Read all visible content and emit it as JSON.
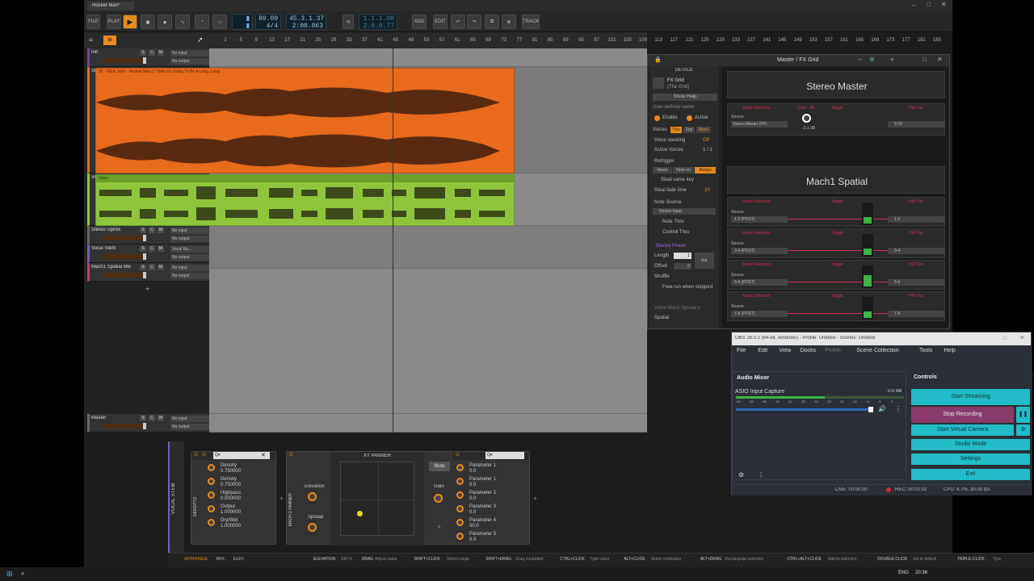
{
  "window": {
    "tab_title": "Rocket Man*"
  },
  "toolbar": {
    "file": "FILE",
    "play": "PLAY",
    "tempo": "89.00",
    "timesig": "4/4",
    "position_bars": "45.3.1.37",
    "position_time": "2:00.063",
    "loop_start": "1.1.1.00",
    "loop_end": "2.0.0.77",
    "add": "ADD",
    "edit": "EDIT",
    "track": "TRACK"
  },
  "ruler": {
    "ticks": [
      "1",
      "5",
      "9",
      "13",
      "17",
      "21",
      "25",
      "29",
      "33",
      "37",
      "41",
      "45",
      "49",
      "53",
      "57",
      "61",
      "65",
      "69",
      "73",
      "77",
      "81",
      "85",
      "89",
      "93",
      "97",
      "101",
      "105",
      "109",
      "113",
      "117",
      "121",
      "125",
      "129",
      "133",
      "137",
      "141",
      "145",
      "149",
      "153",
      "157",
      "161",
      "165",
      "169",
      "173",
      "177",
      "181",
      "185"
    ]
  },
  "tracks": [
    {
      "name": "Init",
      "in": "No input",
      "out": "No output",
      "color": "#8a3aa8"
    },
    {
      "name": "Stereo Master",
      "in": "No input",
      "out": "No output",
      "color": "#e86a1c"
    },
    {
      "name": "Vocal RipX",
      "in": "No input",
      "out": "No output",
      "color": "#8fc43c"
    },
    {
      "name": "Stereo Upmix",
      "in": "No input",
      "out": "No output",
      "color": "#666666"
    },
    {
      "name": "Vocal Stem",
      "in": "Vocal Ru...",
      "out": "No output",
      "color": "#7a5ac8"
    },
    {
      "name": "Mach1 Spatial Mix",
      "in": "No input",
      "out": "No output",
      "color": "#c83a7a"
    },
    {
      "name": "Master",
      "in": "No input",
      "out": "No output",
      "color": "#666666"
    }
  ],
  "clips": {
    "clip1_title": "05 - Elton John - Rocket Man (I Think It's Going To Be A Long, Long",
    "clip2_title": "Voice"
  },
  "inspector": {
    "title": "Master / FX Grid",
    "device_header": "DEVICE",
    "device_name": "FX Grid",
    "device_sub": "(The Grid)",
    "show_help": "Show Help",
    "user_defined": "User-defined name",
    "enable": "Enable",
    "active": "Active",
    "voices": "Voices",
    "voices_opts": [
      "True",
      "Digi",
      "Mono"
    ],
    "voice_stacking": "Voice stacking",
    "voice_stacking_val": "Off",
    "active_voices": "Active Voices",
    "active_voices_val": "1 / 1",
    "retrigger": "Retrigger",
    "retrigger_opts": [
      "Never",
      "Note on",
      "Always"
    ],
    "steal": "Steal same key",
    "steal_fade": "Steal fade time",
    "steal_fade_val": "10",
    "note_source": "Note Source",
    "device_input": "Device Input",
    "note_thru": "Note Thru",
    "control_thru": "Control Thru",
    "device_phase": "Device Phase",
    "length": "Length",
    "length_val": "1",
    "length_unit": "bar",
    "offset": "Offset",
    "offset_val": "0",
    "shuffle": "Shuffle",
    "freerun": "Free-run when stopped",
    "voice_stack_spread": "Voice Stack Spread x",
    "spatial": "Spatial",
    "stereo_master": "Stereo Master",
    "mach1": "Mach1 Spatial",
    "source": "Source",
    "src_main": "Stereo Master (PO...",
    "db": "-3.1 dB",
    "hw_main": "9-10",
    "lbl_audio": "Audio Selection",
    "lbl_gain": "Gain - dB",
    "lbl_toggle": "Toggle",
    "lbl_hw": "HW Out",
    "mach_sources": [
      "1-2 (POST)",
      "3-4 (POST)",
      "5-6 (POST)",
      "7-8 (POST)"
    ],
    "mach_outs": [
      "1-2",
      "3-4",
      "5-6",
      "7-8"
    ]
  },
  "obs": {
    "title": "OBS 28.0.1 (64-bit, windows) - Profile: Untitled - Scenes: Untitled",
    "menu": [
      "File",
      "Edit",
      "View",
      "Docks",
      "Profile",
      "Scene Collection",
      "Tools",
      "Help"
    ],
    "mixer_title": "Audio Mixer",
    "controls_title": "Controls",
    "source_name": "ASIO Input Capture",
    "source_db": "0.0 dB",
    "meter_ticks": [
      "-60",
      "-55",
      "-50",
      "-45",
      "-40",
      "-35",
      "-30",
      "-25",
      "-20",
      "-15",
      "-10",
      "-5",
      "0"
    ],
    "buttons": {
      "stream": "Start Streaming",
      "record": "Stop Recording",
      "vcam": "Start Virtual Camera",
      "studio": "Studio Mode",
      "settings": "Settings",
      "exit": "Exit"
    },
    "status": {
      "live": "LIVE: 00:00:00",
      "rec": "REC: 00:02:02",
      "cpu": "CPU: 4.7%, 30.00 fps"
    },
    "accent": "#22bcc8"
  },
  "devices": {
    "track_label": "VOCAL STEM",
    "density_label": "DENSITY2",
    "d1": [
      {
        "name": "Density",
        "val": "0.750000"
      },
      {
        "name": "Density",
        "val": "0.750000"
      },
      {
        "name": "Highpass",
        "val": "0.000000"
      },
      {
        "name": "Output",
        "val": "1.000000"
      },
      {
        "name": "Dry/Wet",
        "val": "1.000000"
      }
    ],
    "panner_label": "MACH 1 PANNER",
    "xy_title": "XY PANNER",
    "elevation": "Elevation",
    "spread": "Spread",
    "mute": "Mute",
    "gain": "Gain",
    "params": [
      {
        "name": "Parameter 1",
        "val": "0.0"
      },
      {
        "name": "Parameter 1",
        "val": "0.0"
      },
      {
        "name": "Parameter 2",
        "val": "0.0"
      },
      {
        "name": "Parameter 3",
        "val": "0.0"
      },
      {
        "name": "Parameter 4",
        "val": "50.0"
      },
      {
        "name": "Parameter 5",
        "val": "0.0"
      }
    ]
  },
  "statusbar": {
    "modes": [
      "ARRANGE",
      "MIX",
      "EDIT"
    ],
    "hints": [
      {
        "k": "ELEVATION",
        "v": "100 %"
      },
      {
        "k": "DRAG",
        "v": "Adjust value"
      },
      {
        "k": "SHIFT+CLICK",
        "v": "Select range"
      },
      {
        "k": "SHIFT+DRAG",
        "v": "Drag modulator"
      },
      {
        "k": "CTRL+CLICK",
        "v": "Type value"
      },
      {
        "k": "ALT+CLICK",
        "v": "Select modulator"
      },
      {
        "k": "ALT+DRAG",
        "v": "Rectangular selection"
      },
      {
        "k": "CTRL+ALT+CLICK",
        "v": "Add to selection"
      },
      {
        "k": "DOUBLE-CLICK",
        "v": "Set to default"
      },
      {
        "k": "TRIPLE-CLICK",
        "v": "Type"
      }
    ]
  },
  "taskbar": {
    "lang": "ENG",
    "time": "20:36"
  }
}
